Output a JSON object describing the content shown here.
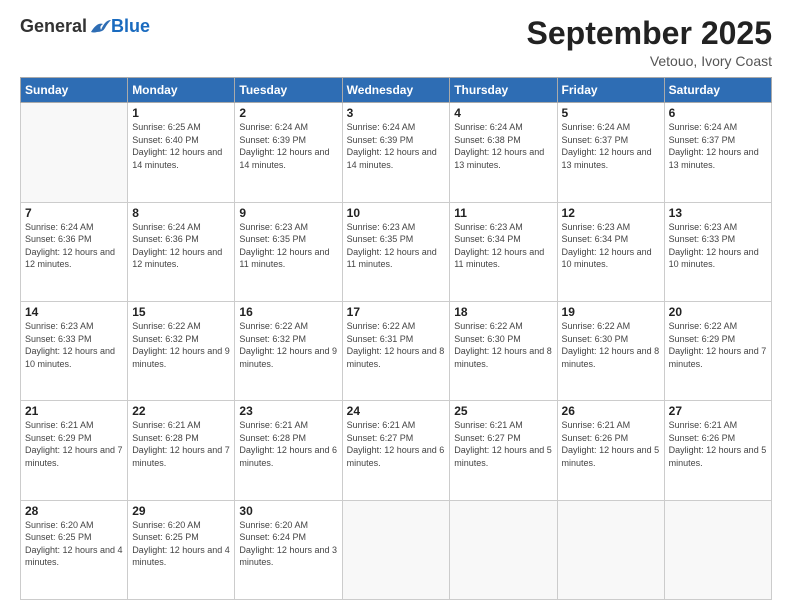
{
  "logo": {
    "general": "General",
    "blue": "Blue"
  },
  "title": "September 2025",
  "subtitle": "Vetouo, Ivory Coast",
  "days_header": [
    "Sunday",
    "Monday",
    "Tuesday",
    "Wednesday",
    "Thursday",
    "Friday",
    "Saturday"
  ],
  "weeks": [
    [
      {
        "day": "",
        "info": ""
      },
      {
        "day": "1",
        "info": "Sunrise: 6:25 AM\nSunset: 6:40 PM\nDaylight: 12 hours\nand 14 minutes."
      },
      {
        "day": "2",
        "info": "Sunrise: 6:24 AM\nSunset: 6:39 PM\nDaylight: 12 hours\nand 14 minutes."
      },
      {
        "day": "3",
        "info": "Sunrise: 6:24 AM\nSunset: 6:39 PM\nDaylight: 12 hours\nand 14 minutes."
      },
      {
        "day": "4",
        "info": "Sunrise: 6:24 AM\nSunset: 6:38 PM\nDaylight: 12 hours\nand 13 minutes."
      },
      {
        "day": "5",
        "info": "Sunrise: 6:24 AM\nSunset: 6:37 PM\nDaylight: 12 hours\nand 13 minutes."
      },
      {
        "day": "6",
        "info": "Sunrise: 6:24 AM\nSunset: 6:37 PM\nDaylight: 12 hours\nand 13 minutes."
      }
    ],
    [
      {
        "day": "7",
        "info": "Sunrise: 6:24 AM\nSunset: 6:36 PM\nDaylight: 12 hours\nand 12 minutes."
      },
      {
        "day": "8",
        "info": "Sunrise: 6:24 AM\nSunset: 6:36 PM\nDaylight: 12 hours\nand 12 minutes."
      },
      {
        "day": "9",
        "info": "Sunrise: 6:23 AM\nSunset: 6:35 PM\nDaylight: 12 hours\nand 11 minutes."
      },
      {
        "day": "10",
        "info": "Sunrise: 6:23 AM\nSunset: 6:35 PM\nDaylight: 12 hours\nand 11 minutes."
      },
      {
        "day": "11",
        "info": "Sunrise: 6:23 AM\nSunset: 6:34 PM\nDaylight: 12 hours\nand 11 minutes."
      },
      {
        "day": "12",
        "info": "Sunrise: 6:23 AM\nSunset: 6:34 PM\nDaylight: 12 hours\nand 10 minutes."
      },
      {
        "day": "13",
        "info": "Sunrise: 6:23 AM\nSunset: 6:33 PM\nDaylight: 12 hours\nand 10 minutes."
      }
    ],
    [
      {
        "day": "14",
        "info": "Sunrise: 6:23 AM\nSunset: 6:33 PM\nDaylight: 12 hours\nand 10 minutes."
      },
      {
        "day": "15",
        "info": "Sunrise: 6:22 AM\nSunset: 6:32 PM\nDaylight: 12 hours\nand 9 minutes."
      },
      {
        "day": "16",
        "info": "Sunrise: 6:22 AM\nSunset: 6:32 PM\nDaylight: 12 hours\nand 9 minutes."
      },
      {
        "day": "17",
        "info": "Sunrise: 6:22 AM\nSunset: 6:31 PM\nDaylight: 12 hours\nand 8 minutes."
      },
      {
        "day": "18",
        "info": "Sunrise: 6:22 AM\nSunset: 6:30 PM\nDaylight: 12 hours\nand 8 minutes."
      },
      {
        "day": "19",
        "info": "Sunrise: 6:22 AM\nSunset: 6:30 PM\nDaylight: 12 hours\nand 8 minutes."
      },
      {
        "day": "20",
        "info": "Sunrise: 6:22 AM\nSunset: 6:29 PM\nDaylight: 12 hours\nand 7 minutes."
      }
    ],
    [
      {
        "day": "21",
        "info": "Sunrise: 6:21 AM\nSunset: 6:29 PM\nDaylight: 12 hours\nand 7 minutes."
      },
      {
        "day": "22",
        "info": "Sunrise: 6:21 AM\nSunset: 6:28 PM\nDaylight: 12 hours\nand 7 minutes."
      },
      {
        "day": "23",
        "info": "Sunrise: 6:21 AM\nSunset: 6:28 PM\nDaylight: 12 hours\nand 6 minutes."
      },
      {
        "day": "24",
        "info": "Sunrise: 6:21 AM\nSunset: 6:27 PM\nDaylight: 12 hours\nand 6 minutes."
      },
      {
        "day": "25",
        "info": "Sunrise: 6:21 AM\nSunset: 6:27 PM\nDaylight: 12 hours\nand 5 minutes."
      },
      {
        "day": "26",
        "info": "Sunrise: 6:21 AM\nSunset: 6:26 PM\nDaylight: 12 hours\nand 5 minutes."
      },
      {
        "day": "27",
        "info": "Sunrise: 6:21 AM\nSunset: 6:26 PM\nDaylight: 12 hours\nand 5 minutes."
      }
    ],
    [
      {
        "day": "28",
        "info": "Sunrise: 6:20 AM\nSunset: 6:25 PM\nDaylight: 12 hours\nand 4 minutes."
      },
      {
        "day": "29",
        "info": "Sunrise: 6:20 AM\nSunset: 6:25 PM\nDaylight: 12 hours\nand 4 minutes."
      },
      {
        "day": "30",
        "info": "Sunrise: 6:20 AM\nSunset: 6:24 PM\nDaylight: 12 hours\nand 3 minutes."
      },
      {
        "day": "",
        "info": ""
      },
      {
        "day": "",
        "info": ""
      },
      {
        "day": "",
        "info": ""
      },
      {
        "day": "",
        "info": ""
      }
    ]
  ]
}
